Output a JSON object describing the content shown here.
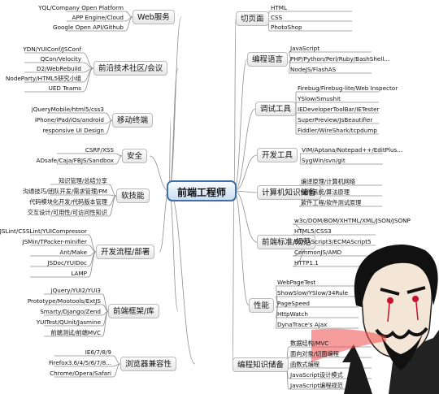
{
  "center": "前端工程师",
  "left": [
    {
      "title": "Web服务",
      "items": [
        "YQL/Company Open Platform",
        "APP Engine/Cloud",
        "Google Open API/Github"
      ]
    },
    {
      "title": "前沿技术社区/会议",
      "items": [
        "YDN/YUIConf/JSConf",
        "QCon/Velocity",
        "D2/WebRebuild",
        "NodeParty/HTML5研究小组",
        "UED Teams"
      ]
    },
    {
      "title": "移动终端",
      "items": [
        "jQueryMobile/html5/css3",
        "iPhone/iPad/iOs/android",
        "responsive UI Design"
      ]
    },
    {
      "title": "安全",
      "items": [
        "CSRF/XSS",
        "ADsafe/Caja/FBJS/Sandbox"
      ]
    },
    {
      "title": "软技能",
      "items": [
        "知识管理/总结分享",
        "沟通技巧/团队开发/需求管理/PM",
        "代码模块化开发/代码版本管理",
        "交互设计/可用性/可访问性知识"
      ]
    },
    {
      "title": "开发流程/部署",
      "items": [
        "JSLint/CSSLint/YUICompressor",
        "JSMin/TPacker-minifier",
        "Ant/Make",
        "JSDoc/YUIDoc",
        "LAMP"
      ]
    },
    {
      "title": "前端框架/库",
      "items": [
        "jQuery/YUI2/YUI3",
        "Prototype/Mootools/ExtJS",
        "Smarty/Django/Zend",
        "YUITest/QUnit/Jasmine",
        "前端测试/前端MVC"
      ]
    },
    {
      "title": "浏览器兼容性",
      "items": [
        "IE6/7/8/9",
        "Firefox3.6/4/5/6/7/8...",
        "Chrome/Opera/Safari"
      ]
    }
  ],
  "right": [
    {
      "title": "切页面",
      "items": [
        "HTML",
        "CSS",
        "PhotoShop"
      ]
    },
    {
      "title": "编程语言",
      "items": [
        "JavaScript",
        "PHP/Python/Perl/Ruby/BashShell...",
        "NodeJS/FlashAS"
      ]
    },
    {
      "title": "调试工具",
      "items": [
        "Firebug/Firebug-lite/Web Inspector",
        "YSlow/Smushit",
        "IEDeveloperToolBar/IETester",
        "SuperPreview/JsBeautifier",
        "Fiddler/WireShark/tcpdump"
      ]
    },
    {
      "title": "开发工具",
      "items": [
        "VIM/Aptana/Notepad++/EditPlus...",
        "SygWin/svn/git"
      ]
    },
    {
      "title": "计算机知识储备",
      "items": [
        "编译原理/计算机网络",
        "操作系统/算法原理",
        "软件工程/软件测试原理"
      ]
    },
    {
      "title": "前端标准/规范",
      "items": [
        "w3c/DOM/BOM/XHTML/XML/JSON/JSONP",
        "HTML5/CSS3",
        "ECMAScript3/ECMAScript5",
        "CommonJS/AMD",
        "HTTP1.1"
      ]
    },
    {
      "title": "性能",
      "items": [
        "WebPageTest",
        "ShowSlow/YSlow/34Rule",
        "PageSpeed",
        "HttpWatch",
        "DynaTrace's Ajax"
      ]
    },
    {
      "title": "编程知识储备",
      "items": [
        "数据结构/MVC",
        "面向对象/切面编程",
        "函数式编程",
        "JavaScript设计模式",
        "JavaScript编程规范"
      ]
    }
  ],
  "colors": {
    "line": "#8e8e8e",
    "center_border": "#3f6ea8"
  }
}
